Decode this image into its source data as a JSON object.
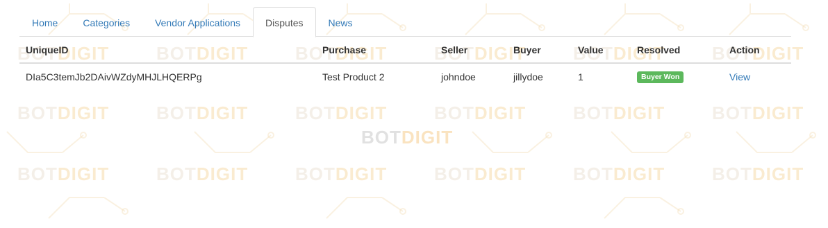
{
  "nav": {
    "tabs": [
      {
        "label": "Home",
        "active": false
      },
      {
        "label": "Categories",
        "active": false
      },
      {
        "label": "Vendor Applications",
        "active": false
      },
      {
        "label": "Disputes",
        "active": true
      },
      {
        "label": "News",
        "active": false
      }
    ]
  },
  "table": {
    "headers": {
      "unique_id": "UniqueID",
      "purchase": "Purchase",
      "seller": "Seller",
      "buyer": "Buyer",
      "value": "Value",
      "resolved": "Resolved",
      "action": "Action"
    },
    "rows": [
      {
        "unique_id": "DIa5C3temJb2DAivWZdyMHJLHQERPg",
        "purchase": "Test Product 2",
        "seller": "johndoe",
        "buyer": "jillydoe",
        "value": "1",
        "resolved": "Buyer Won",
        "action": "View"
      }
    ]
  },
  "watermark": {
    "text_a": "BOT",
    "text_b": "DIGIT"
  },
  "colors": {
    "link": "#337ab7",
    "active_tab_text": "#555555",
    "border": "#dddddd",
    "success_badge": "#5cb85c"
  }
}
